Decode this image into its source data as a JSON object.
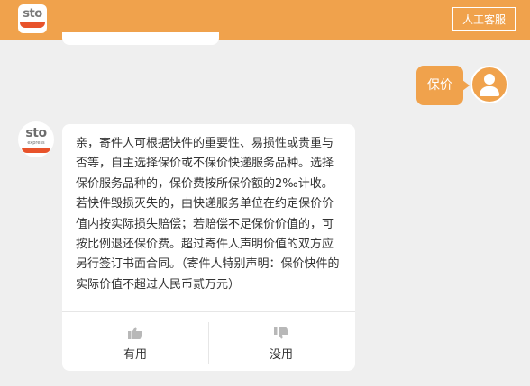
{
  "header": {
    "logo_text": "sto",
    "service_button": "人工客服"
  },
  "chat": {
    "user_message": "保价",
    "bot_logo_text": "sto",
    "bot_logo_sub": "express",
    "bot_answer": "亲，寄件人可根据快件的重要性、易损性或贵重与否等，自主选择保价或不保价快递服务品种。选择保价服务品种的，保价费按所保价额的2‰计收。若快件毁损灭失的，由快递服务单位在约定保价价值内按实际损失赔偿；若赔偿不足保价价值的，可按比例退还保价费。超过寄件人声明价值的双方应另行签订书面合同。（寄件人特别声明：保价快件的实际价值不超过人民币贰万元）",
    "feedback": {
      "useful_label": "有用",
      "useless_label": "没用"
    }
  },
  "colors": {
    "brand_orange": "#f0a24c",
    "logo_red": "#e8532b",
    "background": "#efefef",
    "card": "#ffffff"
  },
  "icons": {
    "thumbs_up": "thumbs-up-icon",
    "thumbs_down": "thumbs-down-icon",
    "user_avatar": "user-icon"
  }
}
